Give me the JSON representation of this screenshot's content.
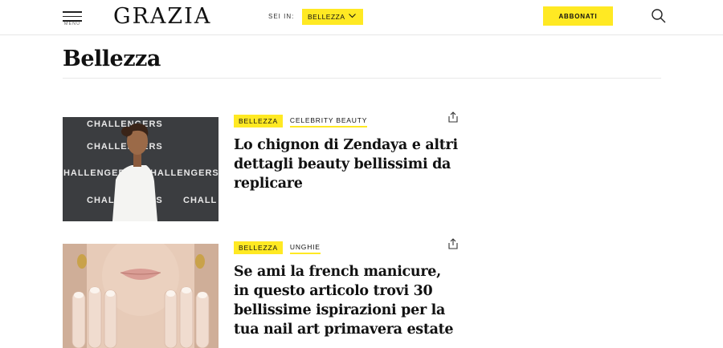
{
  "header": {
    "menu_label": "MENU",
    "logo": "GRAZIA",
    "sei_in_label": "SEI IN:",
    "section_value": "BELLEZZA",
    "subscribe_label": "ABBONATI",
    "accent_color": "#ffe923"
  },
  "page": {
    "title": "Bellezza"
  },
  "articles": [
    {
      "tag_primary": "BELLEZZA",
      "tag_secondary": "CELEBRITY BEAUTY",
      "headline": "Lo chignon di Zendaya e altri dettagli beauty bellissimi da replicare",
      "image_words": [
        "CHALLENGERS",
        "CHALLENGERS",
        "CHALLENGERS",
        "CHALLENGERS",
        "CHALLENGERS",
        "CHALL"
      ]
    },
    {
      "tag_primary": "BELLEZZA",
      "tag_secondary": "UNGHIE",
      "headline": "Se ami la french manicure, in questo articolo trovi 30 bellissime ispirazioni per la tua nail art primavera estate"
    }
  ]
}
